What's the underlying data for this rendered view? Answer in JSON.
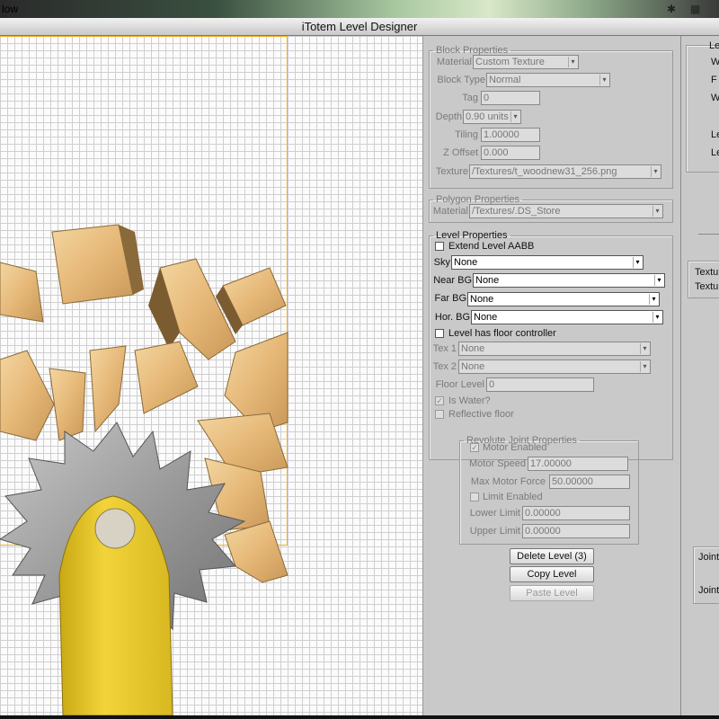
{
  "menubar": {
    "app_name": "low"
  },
  "window": {
    "title": "iTotem Level Designer"
  },
  "block": {
    "legend": "Block Properties",
    "material_label": "Material",
    "material_value": "Custom Texture",
    "block_type_label": "Block Type",
    "block_type_value": "Normal",
    "tag_label": "Tag",
    "tag_value": "0",
    "depth_label": "Depth",
    "depth_value": "0.90 units",
    "tiling_label": "Tiling",
    "tiling_value": "1.00000",
    "zoffset_label": "Z Offset",
    "zoffset_value": "0.000",
    "texture_label": "Texture",
    "texture_value": "/Textures/t_woodnew31_256.png"
  },
  "polygon": {
    "legend": "Polygon Properties",
    "material_label": "Material",
    "material_value": "/Textures/.DS_Store"
  },
  "level": {
    "legend": "Level Properties",
    "extend_aabb_label": "Extend Level AABB",
    "sky_label": "Sky",
    "sky_value": "None",
    "near_bg_label": "Near BG",
    "near_bg_value": "None",
    "far_bg_label": "Far BG",
    "far_bg_value": "None",
    "hor_bg_label": "Hor. BG",
    "hor_bg_value": "None",
    "floor_controller_label": "Level has floor controller",
    "tex1_label": "Tex 1",
    "tex1_value": "None",
    "tex2_label": "Tex 2",
    "tex2_value": "None",
    "floor_level_label": "Floor Level",
    "floor_level_value": "0",
    "is_water_label": "Is Water?",
    "reflective_floor_label": "Reflective floor"
  },
  "joint": {
    "legend": "Revolute Joint Properties",
    "motor_enabled_label": "Motor Enabled",
    "motor_speed_label": "Motor Speed",
    "motor_speed_value": "17.00000",
    "max_motor_force_label": "Max Motor Force",
    "max_motor_force_value": "50.00000",
    "limit_enabled_label": "Limit Enabled",
    "lower_limit_label": "Lower Limit",
    "lower_limit_value": "0.00000",
    "upper_limit_label": "Upper Limit",
    "upper_limit_value": "0.00000"
  },
  "actions": {
    "delete_level": "Delete Level (3)",
    "copy_level": "Copy Level",
    "paste_level": "Paste Level"
  },
  "right_stub": {
    "l1": "Le",
    "l2": "W",
    "l3": "F",
    "l4": "W",
    "l5": "Le",
    "l6": "Le",
    "texture1": "Textur",
    "texture2": "Textur",
    "joint1": "Joint",
    "joint2": "Joint"
  }
}
